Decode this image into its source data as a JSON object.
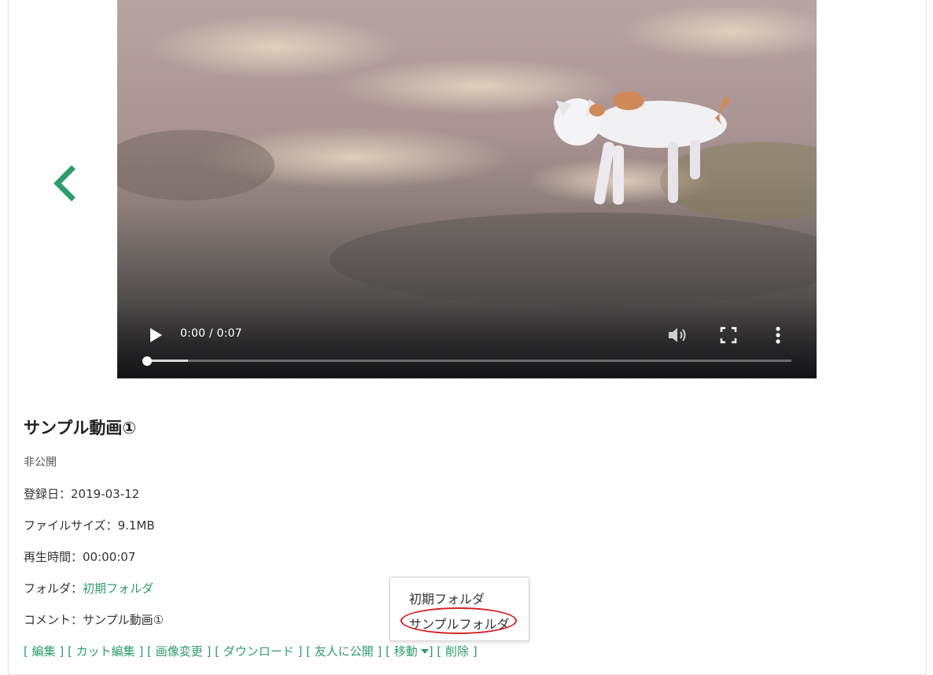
{
  "player": {
    "time_display": "0:00 / 0:07",
    "progress": 0.0,
    "buffered": 0.063
  },
  "media": {
    "title": "サンプル動画①",
    "visibility": "非公開",
    "registered_label": "登録日：",
    "registered_value": "2019-03-12",
    "filesize_label": "ファイルサイズ：",
    "filesize_value": "9.1MB",
    "duration_label": "再生時間：",
    "duration_value": "00:00:07",
    "folder_label": "フォルダ：",
    "folder_value": "初期フォルダ",
    "comment_label": "コメント：",
    "comment_value": "サンプル動画①"
  },
  "actions": {
    "edit": "編集",
    "cut_edit": "カット編集",
    "change_image": "画像変更",
    "download": "ダウンロード",
    "publish_friends": "友人に公開",
    "move": "移動",
    "delete": "削除"
  },
  "move_menu": {
    "items": [
      "初期フォルダ",
      "サンプルフォルダ"
    ],
    "highlighted_index": 1
  },
  "colors": {
    "accent": "#2e9c6b",
    "highlight_circle": "#d42020"
  },
  "icons": [
    "chevron-left-icon",
    "play-icon",
    "volume-icon",
    "fullscreen-icon",
    "more-vert-icon",
    "caret-down-icon"
  ]
}
